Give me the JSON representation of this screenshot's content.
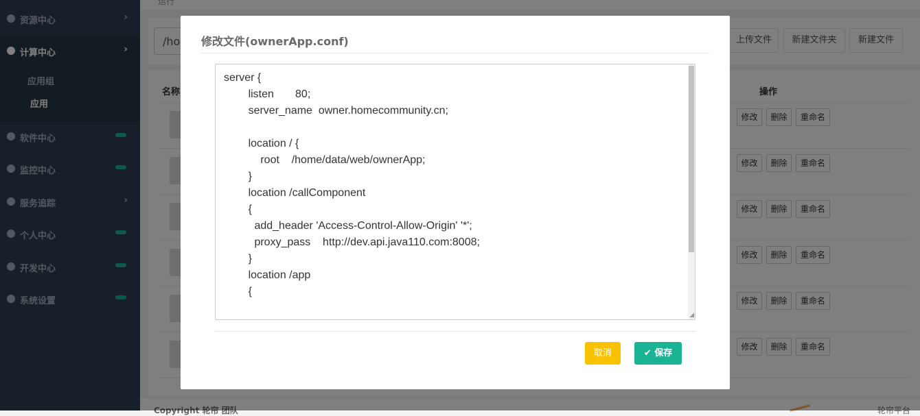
{
  "sidebar": {
    "items": [
      {
        "label": "资源中心",
        "indicator": "chevron"
      },
      {
        "label": "计算中心",
        "indicator": "chevron"
      },
      {
        "label": "软件中心",
        "indicator": "badge"
      },
      {
        "label": "监控中心",
        "indicator": "badge"
      },
      {
        "label": "服务追踪",
        "indicator": "chevron"
      },
      {
        "label": "个人中心",
        "indicator": "badge"
      },
      {
        "label": "开发中心",
        "indicator": "badge"
      },
      {
        "label": "系统设置",
        "indicator": "badge"
      }
    ],
    "sub_items": [
      "应用组",
      "应用"
    ],
    "chevron_glyph": "›"
  },
  "breadcrumb": "运行",
  "toolbar": {
    "path_value": "/ho",
    "upload_label": "上传文件",
    "new_folder_label": "新建文件夹",
    "new_file_label": "新建文件"
  },
  "table": {
    "col_name": "名称",
    "col_actions": "操作",
    "row_actions": [
      "修改",
      "删除",
      "重命名"
    ],
    "row_count": 6
  },
  "footer": {
    "copyright": "Copyright 轮帘 团队",
    "right_text": "轮帘平台"
  },
  "modal": {
    "title": "修改文件(ownerApp.conf)",
    "content": "server {\n        listen       80;\n        server_name  owner.homecommunity.cn;\n\n        location / {\n            root    /home/data/web/ownerApp;\n        }\n        location /callComponent\n        {\n          add_header 'Access-Control-Allow-Origin' '*';\n          proxy_pass    http://dev.api.java110.com:8008;\n        }\n        location /app\n        {\n",
    "cancel_label": "取消",
    "save_label": "保存",
    "save_icon": "check-icon"
  },
  "colors": {
    "sidebar_bg": "#2f4050",
    "accent_green": "#1ab394",
    "cancel_yellow": "#f8c200"
  }
}
